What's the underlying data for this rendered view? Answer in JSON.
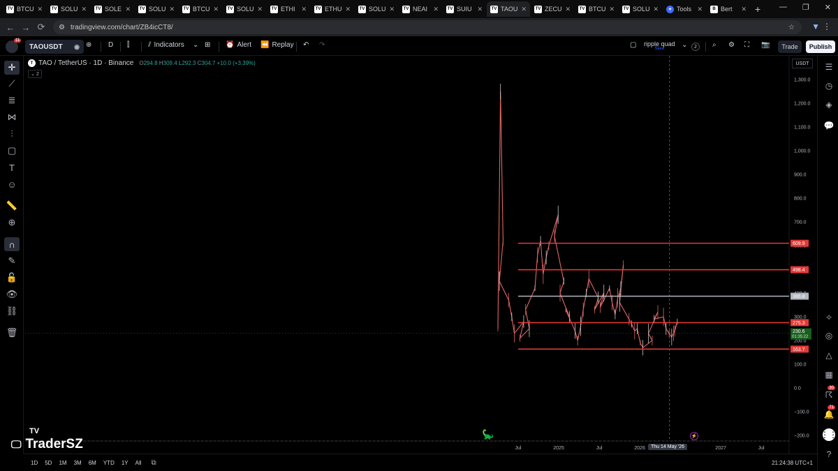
{
  "browser": {
    "tabs": [
      {
        "label": "BTCU",
        "active": false
      },
      {
        "label": "SOLU",
        "active": false
      },
      {
        "label": "SOLE",
        "active": false
      },
      {
        "label": "SOLU",
        "active": false
      },
      {
        "label": "BTCU",
        "active": false
      },
      {
        "label": "SOLU",
        "active": false
      },
      {
        "label": "ETHI",
        "active": false
      },
      {
        "label": "ETHU",
        "active": false
      },
      {
        "label": "SOLU",
        "active": false
      },
      {
        "label": "NEAI",
        "active": false
      },
      {
        "label": "SUIU",
        "active": false
      },
      {
        "label": "TAOU",
        "active": true
      },
      {
        "label": "ZECU",
        "active": false
      },
      {
        "label": "BTCU",
        "active": false
      },
      {
        "label": "SOLU",
        "active": false
      },
      {
        "label": "Tools",
        "active": false
      },
      {
        "label": "Bert",
        "active": false
      }
    ],
    "new_tab": "+",
    "url": "tradingview.com/chart/ZB4icCT8/"
  },
  "toolbar": {
    "avatar_badge": "11",
    "symbol": "TAOUSDT",
    "interval": "D",
    "indicators_label": "Indicators",
    "alert_label": "Alert",
    "replay_label": "Replay",
    "layout_name": "ripple quad",
    "layout_status": "Save",
    "layout_count": "2",
    "trade_label": "Trade",
    "publish_label": "Publish"
  },
  "legend": {
    "title": "TAO / TetherUS · 1D · Binance",
    "o_label": "O",
    "o": "294.8",
    "h_label": "H",
    "h": "309.4",
    "l_label": "L",
    "l": "292.3",
    "c_label": "C",
    "c": "304.7",
    "change": "+10.0 (+3.39%)",
    "indicator_count": "2"
  },
  "price_axis": {
    "currency": "USDT"
  },
  "right_sidebar": {
    "badge_a": "30",
    "badge_b": "71"
  },
  "bottom": {
    "periods": [
      "1D",
      "5D",
      "1M",
      "3M",
      "6M",
      "YTD",
      "1Y",
      "All"
    ],
    "clock": "21:24:38 UTC+1",
    "crosshair_date": "Thu 14 May '26"
  },
  "watermark": {
    "tv_logo": "TV",
    "name": "TraderSZ"
  },
  "colors": {
    "level_red": "#e53935",
    "level_grey": "#b2b5be",
    "candle_up": "#c8c8c8",
    "candle_down": "#e06666"
  },
  "chart_data": {
    "type": "candlestick",
    "y_ticks": [
      1300,
      1200,
      1100,
      1000,
      900,
      800,
      700,
      600,
      500,
      400,
      300,
      200,
      100,
      0,
      -100,
      -200
    ],
    "y_tick_labels": [
      "1,300.0",
      "1,200.0",
      "1,100.0",
      "1,000.0",
      "900.0",
      "800.0",
      "700.0",
      "600.0",
      "500.0",
      "400.0",
      "300.0",
      "200.0",
      "100.0",
      "0.0",
      "−100.0",
      "−200.0"
    ],
    "x_ticks": [
      {
        "label": "Jul",
        "date": "2024-07"
      },
      {
        "label": "2025",
        "date": "2025-01"
      },
      {
        "label": "Jul",
        "date": "2025-07"
      },
      {
        "label": "2026",
        "date": "2026-01"
      },
      {
        "label": "2027",
        "date": "2027-01"
      },
      {
        "label": "Jul",
        "date": "2027-07"
      }
    ],
    "levels": [
      {
        "value": 609.9,
        "label": "609.9",
        "color": "red"
      },
      {
        "value": 498.4,
        "label": "498.4",
        "color": "red"
      },
      {
        "value": 386.8,
        "label": "386.8",
        "color": "grey"
      },
      {
        "value": 275.3,
        "label": "275.3",
        "color": "red"
      },
      {
        "value": 163.7,
        "label": "163.7",
        "color": "red"
      }
    ],
    "last_price": {
      "value": 230.6,
      "label": "230.6",
      "countdown": "01:35:22"
    },
    "price_path": [
      [
        "2024-04",
        250
      ],
      [
        "2024-04",
        1250
      ],
      [
        "2024-04",
        620
      ],
      [
        "2024-04",
        450
      ],
      [
        "2024-05",
        370
      ],
      [
        "2024-06",
        300
      ],
      [
        "2024-06",
        230
      ],
      [
        "2024-07",
        280
      ],
      [
        "2024-07",
        210
      ],
      [
        "2024-08",
        250
      ],
      [
        "2024-08",
        330
      ],
      [
        "2024-09",
        420
      ],
      [
        "2024-09",
        560
      ],
      [
        "2024-10",
        620
      ],
      [
        "2024-10",
        480
      ],
      [
        "2024-11",
        550
      ],
      [
        "2024-11",
        600
      ],
      [
        "2024-12",
        730
      ],
      [
        "2024-12",
        640
      ],
      [
        "2025-01",
        450
      ],
      [
        "2025-01",
        400
      ],
      [
        "2025-02",
        300
      ],
      [
        "2025-02",
        330
      ],
      [
        "2025-03",
        240
      ],
      [
        "2025-03",
        200
      ],
      [
        "2025-04",
        260
      ],
      [
        "2025-04",
        330
      ],
      [
        "2025-05",
        400
      ],
      [
        "2025-05",
        460
      ],
      [
        "2025-06",
        380
      ],
      [
        "2025-06",
        330
      ],
      [
        "2025-07",
        400
      ],
      [
        "2025-07",
        340
      ],
      [
        "2025-08",
        420
      ],
      [
        "2025-08",
        360
      ],
      [
        "2025-09",
        310
      ],
      [
        "2025-09",
        380
      ],
      [
        "2025-10",
        420
      ],
      [
        "2025-10",
        520
      ],
      [
        "2025-10",
        360
      ],
      [
        "2025-11",
        290
      ],
      [
        "2025-11",
        270
      ],
      [
        "2025-12",
        240
      ],
      [
        "2025-12",
        250
      ],
      [
        "2026-01",
        190
      ],
      [
        "2026-01",
        170
      ],
      [
        "2026-02",
        200
      ],
      [
        "2026-02",
        230
      ],
      [
        "2026-03",
        320
      ],
      [
        "2026-03",
        290
      ],
      [
        "2026-04",
        300
      ],
      [
        "2026-04",
        250
      ],
      [
        "2026-05",
        230
      ],
      [
        "2026-05",
        215
      ],
      [
        "2026-06",
        240
      ],
      [
        "2026-06",
        280
      ],
      [
        "2026-06",
        230
      ]
    ]
  }
}
